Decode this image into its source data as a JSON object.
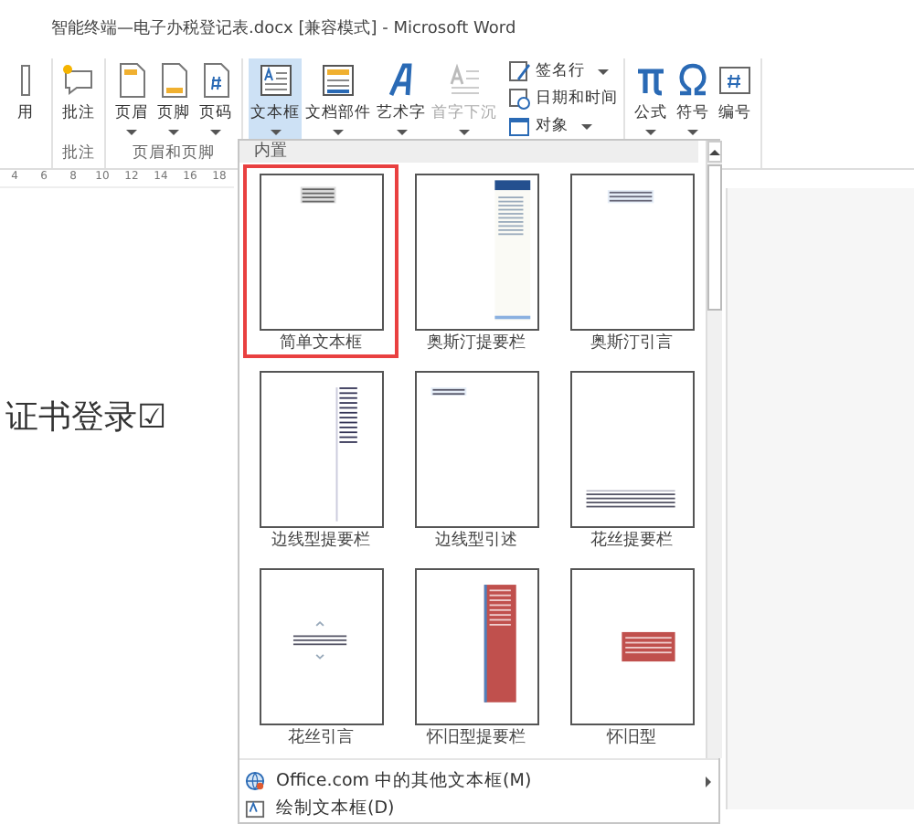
{
  "window": {
    "title": "智能终端—电子办税登记表.docx [兼容模式] - Microsoft Word"
  },
  "ribbon": {
    "groups": [
      {
        "buttons": [
          {
            "label": "用",
            "selected": false,
            "disabled": false,
            "dropdown": false
          }
        ]
      },
      {
        "label": "批注",
        "buttons": [
          {
            "label": "批注",
            "selected": false,
            "disabled": false,
            "dropdown": false
          }
        ]
      },
      {
        "label": "页眉和页脚",
        "buttons": [
          {
            "label": "页眉",
            "selected": false,
            "disabled": false,
            "dropdown": true
          },
          {
            "label": "页脚",
            "selected": false,
            "disabled": false,
            "dropdown": true
          },
          {
            "label": "页码",
            "selected": false,
            "disabled": false,
            "dropdown": true
          }
        ]
      },
      {
        "buttons": [
          {
            "label": "文本框",
            "selected": true,
            "disabled": false,
            "dropdown": true
          },
          {
            "label": "文档部件",
            "selected": false,
            "disabled": false,
            "dropdown": true
          },
          {
            "label": "艺术字",
            "selected": false,
            "disabled": false,
            "dropdown": true
          },
          {
            "label": "首字下沉",
            "selected": false,
            "disabled": true,
            "dropdown": true
          }
        ],
        "small_buttons": [
          {
            "label": "签名行",
            "dropdown": true
          },
          {
            "label": "日期和时间",
            "dropdown": false
          },
          {
            "label": "对象",
            "dropdown": true
          }
        ]
      },
      {
        "buttons": [
          {
            "label": "公式",
            "selected": false,
            "disabled": false,
            "dropdown": true
          },
          {
            "label": "符号",
            "selected": false,
            "disabled": false,
            "dropdown": true
          },
          {
            "label": "编号",
            "selected": false,
            "disabled": false,
            "dropdown": false
          }
        ]
      }
    ]
  },
  "ruler": {
    "ticks": [
      "4",
      "6",
      "8",
      "10",
      "12",
      "14",
      "16",
      "18"
    ]
  },
  "document": {
    "text": "证书登录☑"
  },
  "gallery": {
    "section": "内置",
    "items": [
      {
        "label": "简单文本框",
        "selected": true
      },
      {
        "label": "奥斯汀提要栏",
        "selected": false
      },
      {
        "label": "奥斯汀引言",
        "selected": false
      },
      {
        "label": "边线型提要栏",
        "selected": false
      },
      {
        "label": "边线型引述",
        "selected": false
      },
      {
        "label": "花丝提要栏",
        "selected": false
      },
      {
        "label": "花丝引言",
        "selected": false
      },
      {
        "label": "怀旧型提要栏",
        "selected": false
      },
      {
        "label": "怀旧型",
        "selected": false
      }
    ],
    "menu": [
      {
        "label": "Office.com 中的其他文本框(M)",
        "submenu": true
      },
      {
        "label": "绘制文本框(D)",
        "submenu": false
      }
    ]
  }
}
